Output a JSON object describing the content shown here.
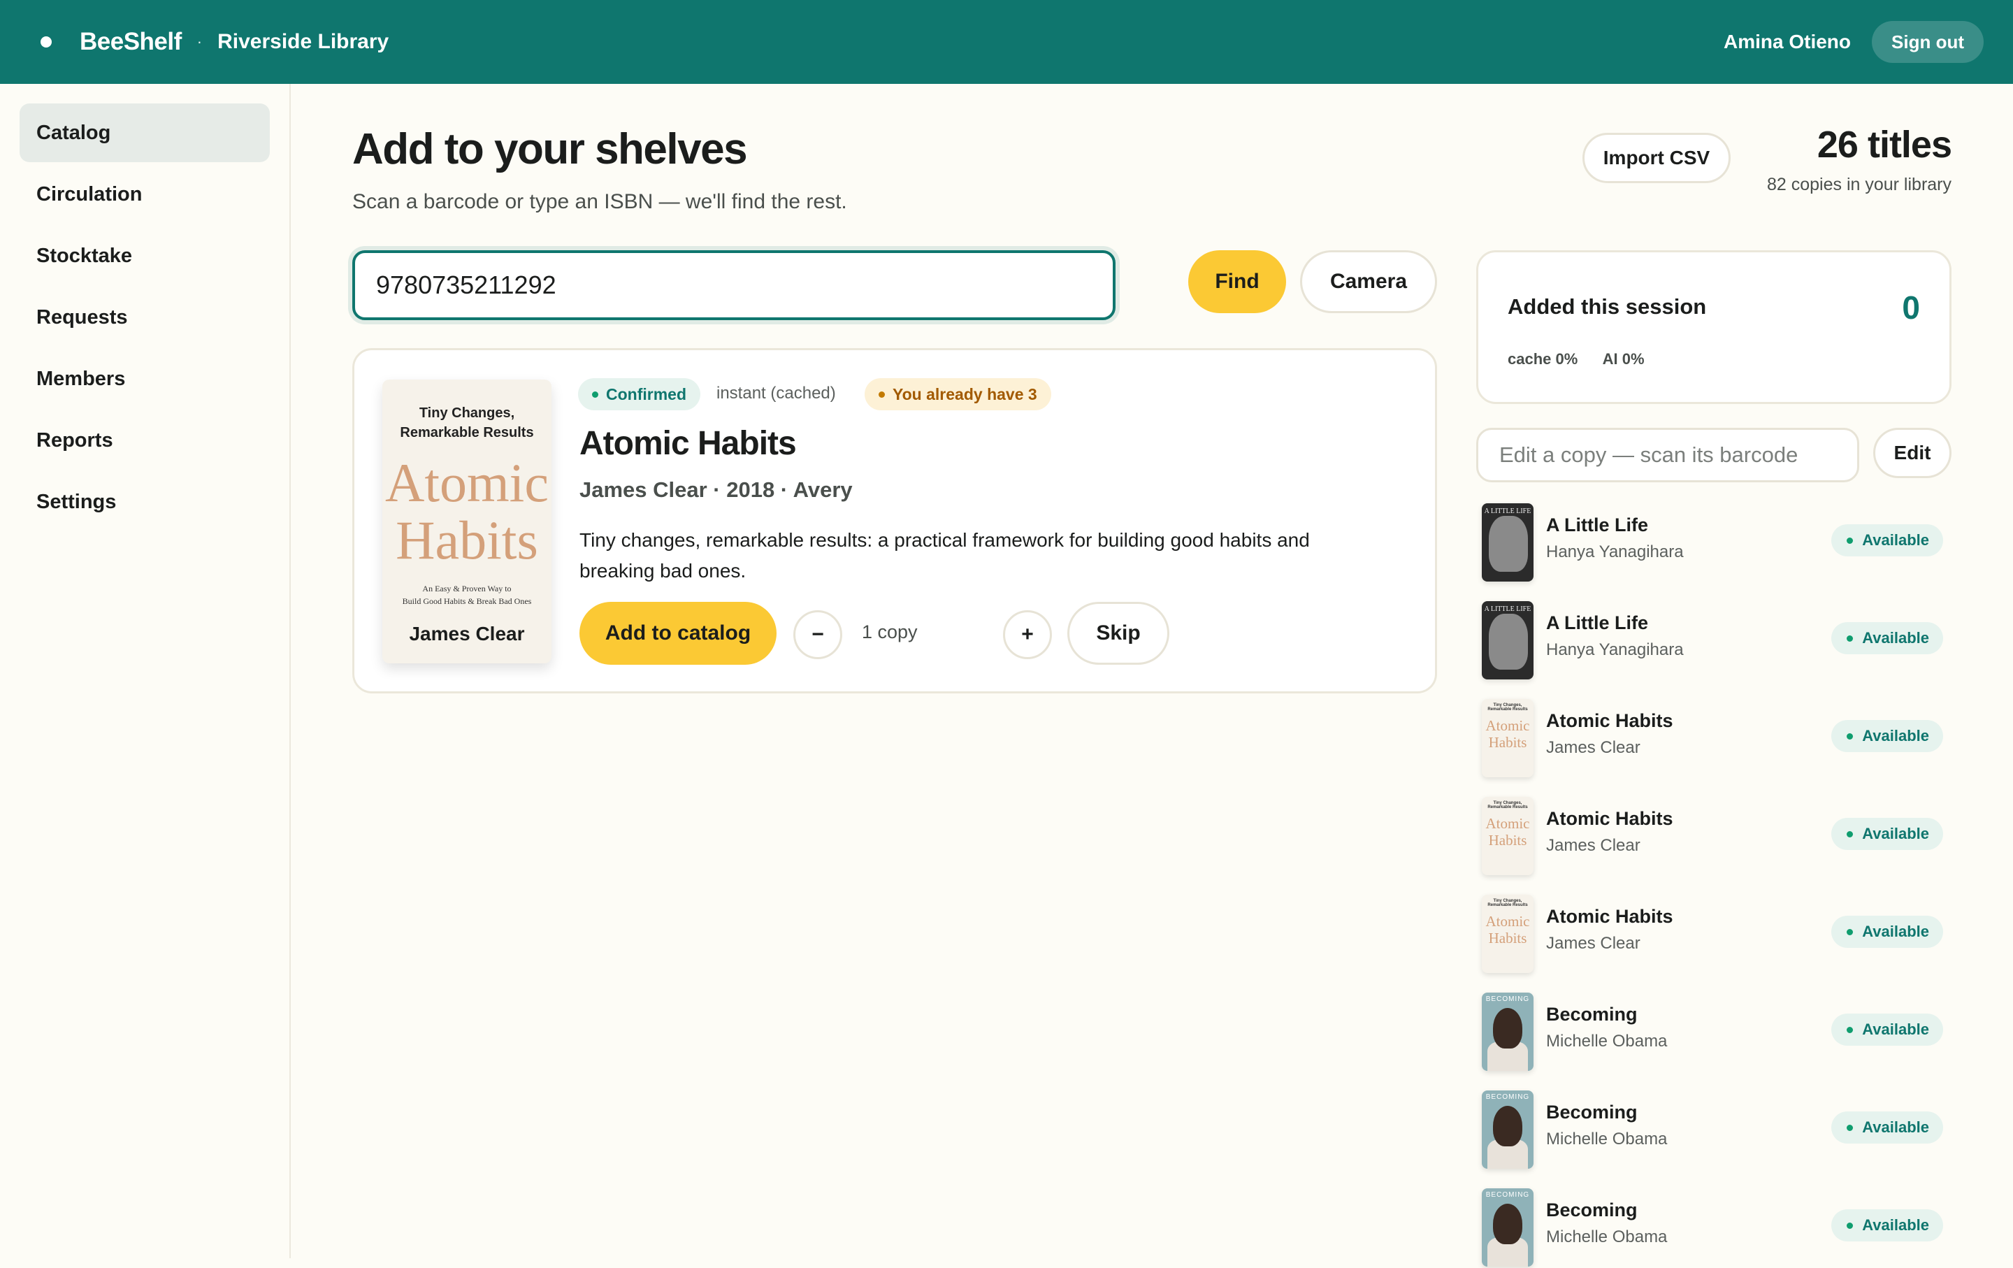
{
  "app": {
    "brand": "BeeShelf",
    "separator": "·",
    "library": "Riverside Library",
    "user": "Amina Otieno",
    "sign_out_label": "Sign out"
  },
  "sidebar": {
    "items": [
      {
        "label": "Catalog",
        "active": true
      },
      {
        "label": "Circulation"
      },
      {
        "label": "Stocktake"
      },
      {
        "label": "Requests"
      },
      {
        "label": "Members"
      },
      {
        "label": "Reports"
      },
      {
        "label": "Settings"
      }
    ]
  },
  "header": {
    "title": "Add to your shelves",
    "subtitle": "Scan a barcode or type an ISBN — we'll find the rest.",
    "import_label": "Import CSV",
    "titles_count": "26 titles",
    "copies_count": "82 copies in your library"
  },
  "search": {
    "value": "9780735211292",
    "find_label": "Find",
    "camera_label": "Camera"
  },
  "result": {
    "cover": {
      "top_text_1": "Tiny Changes,",
      "top_text_2": "Remarkable Results",
      "word_1": "Atomic",
      "word_2": "Habits",
      "sub_1": "An Easy & Proven Way to",
      "sub_2": "Build Good Habits & Break Bad Ones",
      "author": "James Clear"
    },
    "badge_confirmed": "Confirmed",
    "source": "instant (cached)",
    "badge_have": "You already have 3",
    "title": "Atomic Habits",
    "meta": "James Clear · 2018 · Avery",
    "description": "Tiny changes, remarkable results: a practical framework for building good habits and breaking bad ones.",
    "add_label": "Add to catalog",
    "minus_label": "−",
    "qty_label": "1 copy",
    "plus_label": "+",
    "skip_label": "Skip"
  },
  "session": {
    "label": "Added this session",
    "count": "0",
    "cache_stat": "cache 0%",
    "ai_stat": "AI 0%"
  },
  "edit": {
    "placeholder": "Edit a copy — scan its barcode",
    "button_label": "Edit"
  },
  "copies": [
    {
      "title": "A Little Life",
      "author": "Hanya Yanagihara",
      "status": "Available",
      "cover": "little",
      "cover_text": "A LITTLE LIFE"
    },
    {
      "title": "A Little Life",
      "author": "Hanya Yanagihara",
      "status": "Available",
      "cover": "little",
      "cover_text": "A LITTLE LIFE"
    },
    {
      "title": "Atomic Habits",
      "author": "James Clear",
      "status": "Available",
      "cover": "atomic",
      "cover_text": "Atomic Habits",
      "cover_top": "Tiny Changes, Remarkable Results"
    },
    {
      "title": "Atomic Habits",
      "author": "James Clear",
      "status": "Available",
      "cover": "atomic",
      "cover_text": "Atomic Habits",
      "cover_top": "Tiny Changes, Remarkable Results"
    },
    {
      "title": "Atomic Habits",
      "author": "James Clear",
      "status": "Available",
      "cover": "atomic",
      "cover_text": "Atomic Habits",
      "cover_top": "Tiny Changes, Remarkable Results"
    },
    {
      "title": "Becoming",
      "author": "Michelle Obama",
      "status": "Available",
      "cover": "becoming",
      "cover_text": "BECOMING"
    },
    {
      "title": "Becoming",
      "author": "Michelle Obama",
      "status": "Available",
      "cover": "becoming",
      "cover_text": "BECOMING"
    },
    {
      "title": "Becoming",
      "author": "Michelle Obama",
      "status": "Available",
      "cover": "becoming",
      "cover_text": "BECOMING"
    }
  ],
  "colors": {
    "brand": "#0f766e",
    "accent": "#fbc934",
    "background": "#fdfcf6",
    "available": "#0f766e",
    "warning": "#a25a00"
  },
  "icons": {
    "brand": "dot-icon",
    "status": "dot-icon"
  }
}
